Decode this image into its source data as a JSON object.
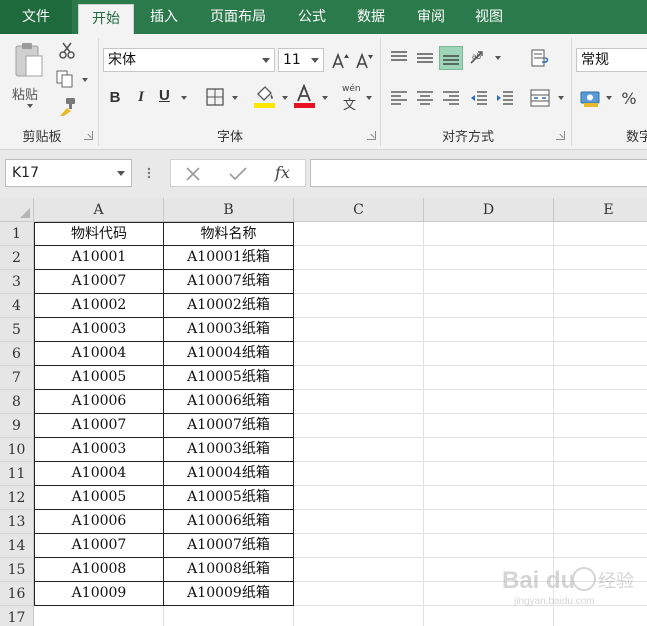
{
  "tabs": [
    {
      "label": "文件",
      "name": "tab-file"
    },
    {
      "label": "开始",
      "name": "tab-home"
    },
    {
      "label": "插入",
      "name": "tab-insert"
    },
    {
      "label": "页面布局",
      "name": "tab-page-layout"
    },
    {
      "label": "公式",
      "name": "tab-formulas"
    },
    {
      "label": "数据",
      "name": "tab-data"
    },
    {
      "label": "审阅",
      "name": "tab-review"
    },
    {
      "label": "视图",
      "name": "tab-view"
    }
  ],
  "ribbon": {
    "clipboard": {
      "label": "剪贴板",
      "paste_label": "粘贴"
    },
    "font": {
      "label": "字体",
      "font_name": "宋体",
      "font_size": "11",
      "phonetic_label": "wén",
      "phonetic_char": "文"
    },
    "alignment": {
      "label": "对齐方式"
    },
    "number": {
      "label": "数字",
      "format": "常规",
      "percent": "%"
    }
  },
  "formula_bar": {
    "name_box": "K17",
    "fx": "fx",
    "formula": ""
  },
  "sheet": {
    "columns": [
      "A",
      "B",
      "C",
      "D",
      "E"
    ],
    "rows": [
      "1",
      "2",
      "3",
      "4",
      "5",
      "6",
      "7",
      "8",
      "9",
      "10",
      "11",
      "12",
      "13",
      "14",
      "15",
      "16",
      "17"
    ],
    "data": [
      [
        "物料代码",
        "物料名称"
      ],
      [
        "A10001",
        "A10001纸箱"
      ],
      [
        "A10007",
        "A10007纸箱"
      ],
      [
        "A10002",
        "A10002纸箱"
      ],
      [
        "A10003",
        "A10003纸箱"
      ],
      [
        "A10004",
        "A10004纸箱"
      ],
      [
        "A10005",
        "A10005纸箱"
      ],
      [
        "A10006",
        "A10006纸箱"
      ],
      [
        "A10007",
        "A10007纸箱"
      ],
      [
        "A10003",
        "A10003纸箱"
      ],
      [
        "A10004",
        "A10004纸箱"
      ],
      [
        "A10005",
        "A10005纸箱"
      ],
      [
        "A10006",
        "A10006纸箱"
      ],
      [
        "A10007",
        "A10007纸箱"
      ],
      [
        "A10008",
        "A10008纸箱"
      ],
      [
        "A10009",
        "A10009纸箱"
      ]
    ]
  },
  "watermark": {
    "brand": "Bai du",
    "label": "经验",
    "url": "jingyan.baidu.com"
  },
  "colors": {
    "accent": "#2b7a4b",
    "tab_file": "#1e6a3c",
    "highlight": "#ffe600",
    "font_color": "#e81123"
  }
}
